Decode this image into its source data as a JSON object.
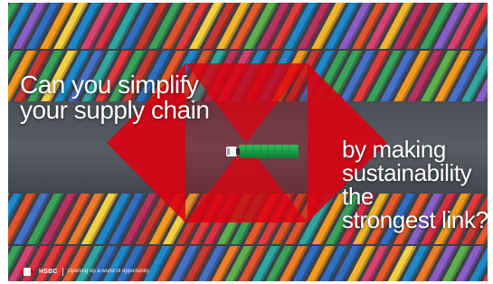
{
  "headline": {
    "lines": [
      "Can you simplify",
      "your supply chain"
    ]
  },
  "subheadline": {
    "lines": [
      "by making",
      "sustainability the",
      "strongest link?"
    ]
  },
  "footer": {
    "brand": "HSBC",
    "tagline": "Opening up a world of opportunity"
  },
  "colors": {
    "brand_red": "#db0011",
    "road": "#4a4e55",
    "truck_cargo": "#22a048"
  }
}
